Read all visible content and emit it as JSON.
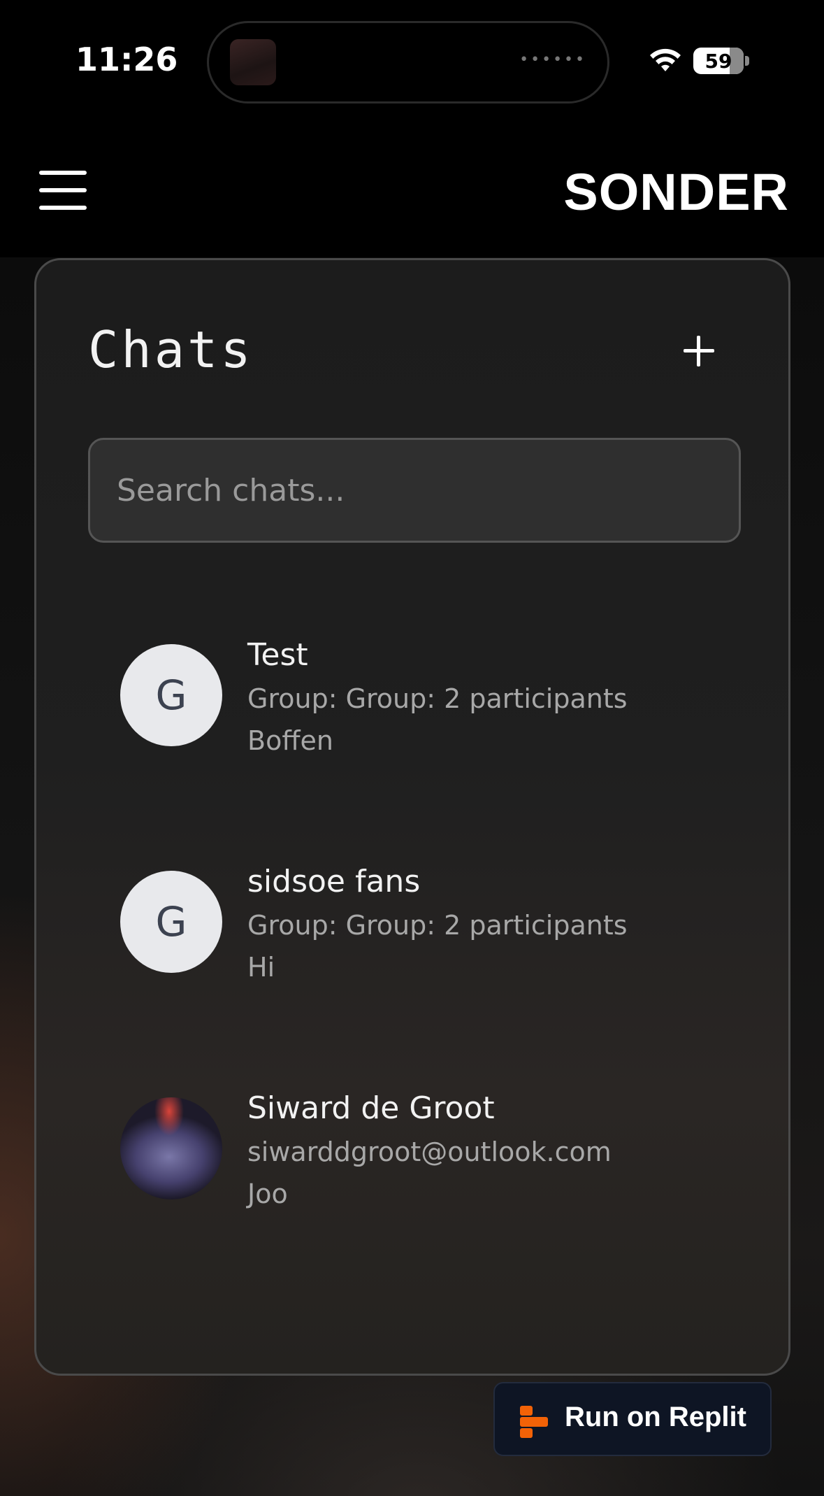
{
  "status_bar": {
    "time": "11:26",
    "battery": "59",
    "icons": [
      "wifi-icon",
      "battery-icon"
    ]
  },
  "header": {
    "brand": "SONDER",
    "menu_icon": "hamburger-menu-icon"
  },
  "chats_panel": {
    "title": "Chats",
    "add_icon": "plus-icon",
    "search": {
      "placeholder": "Search chats...",
      "value": ""
    },
    "items": [
      {
        "avatar": "G",
        "name": "Test",
        "subtitle": "Group: Group: 2 participants",
        "last_message": "Boffen"
      },
      {
        "avatar": "G",
        "name": "sidsoe fans",
        "subtitle": "Group: Group: 2 participants",
        "last_message": "Hi"
      },
      {
        "avatar": "",
        "name": "Siward de Groot",
        "subtitle": "siwarddgroot@outlook.com",
        "last_message": "Joo"
      }
    ]
  },
  "replit_button": {
    "label": "Run on Replit",
    "accent": "#F26207"
  },
  "colors": {
    "background": "#000000",
    "panel_border": "#4A4A4A",
    "avatar_bg": "#E8E9EC",
    "muted_text": "#A8A8A8"
  }
}
